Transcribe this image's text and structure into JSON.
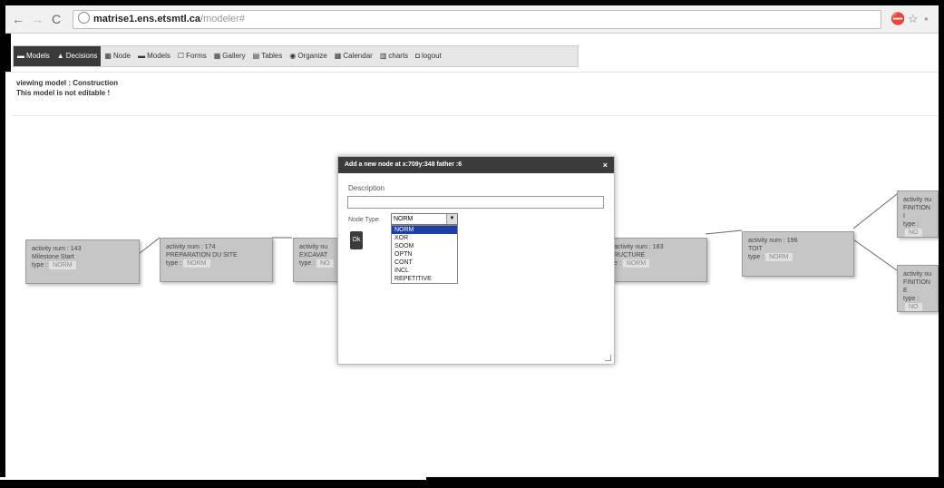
{
  "browser": {
    "url_host": "matrise1.ens.etsmtl.ca",
    "url_path": "/modeler#"
  },
  "nav": {
    "items": [
      {
        "icon": "▬",
        "label": "Models",
        "active": true
      },
      {
        "icon": "▲",
        "label": "Decisions",
        "active": true
      },
      {
        "icon": "▦",
        "label": "Node",
        "active": false
      },
      {
        "icon": "▬",
        "label": "Models",
        "active": false
      },
      {
        "icon": "☐",
        "label": "Forms",
        "active": false
      },
      {
        "icon": "▦",
        "label": "Gallery",
        "active": false
      },
      {
        "icon": "▤",
        "label": "Tables",
        "active": false
      },
      {
        "icon": "◉",
        "label": "Organize",
        "active": false
      },
      {
        "icon": "▦",
        "label": "Calendar",
        "active": false
      },
      {
        "icon": "▥",
        "label": "charts",
        "active": false
      },
      {
        "icon": "◘",
        "label": "logout",
        "active": false
      }
    ]
  },
  "info": {
    "viewing": "viewing model : Construction",
    "not_editable": "This model is not editable !"
  },
  "nodes": [
    {
      "line1": "activity num : 143",
      "line2": "Milestone Start",
      "type_label": "type :",
      "type_value": "NORM"
    },
    {
      "line1": "activity num : 174",
      "line2": "PREPARATION DU SITE",
      "type_label": "type :",
      "type_value": "NORM"
    },
    {
      "line1": "activity nu",
      "line2": "EXCAVAT",
      "type_label": "type :",
      "type_value": "NO"
    },
    {
      "line1": "activity num : 183",
      "line2": "RUCTURE",
      "type_label": "e :",
      "type_value": "NORM"
    },
    {
      "line1": "activity num : 196",
      "line2": "TOIT",
      "type_label": "type :",
      "type_value": "NORM"
    },
    {
      "line1": "activity nu",
      "line2": "FINITION I",
      "type_label": "type :",
      "type_value": "NO"
    },
    {
      "line1": "activity nu",
      "line2": "FINITION E",
      "type_label": "type :",
      "type_value": "NO"
    }
  ],
  "dialog": {
    "title": "Add a new node at x:709y:348 father :6",
    "close": "×",
    "description_label": "Description",
    "description_value": "",
    "node_type_label": "Node Type",
    "node_type_selected": "NORM",
    "ok_label": "Ok",
    "options": [
      "NORM",
      "XOR",
      "SOOM",
      "OPTN",
      "CONT",
      "INCL",
      "REPETITIVE"
    ],
    "selected_option": "NORM"
  }
}
